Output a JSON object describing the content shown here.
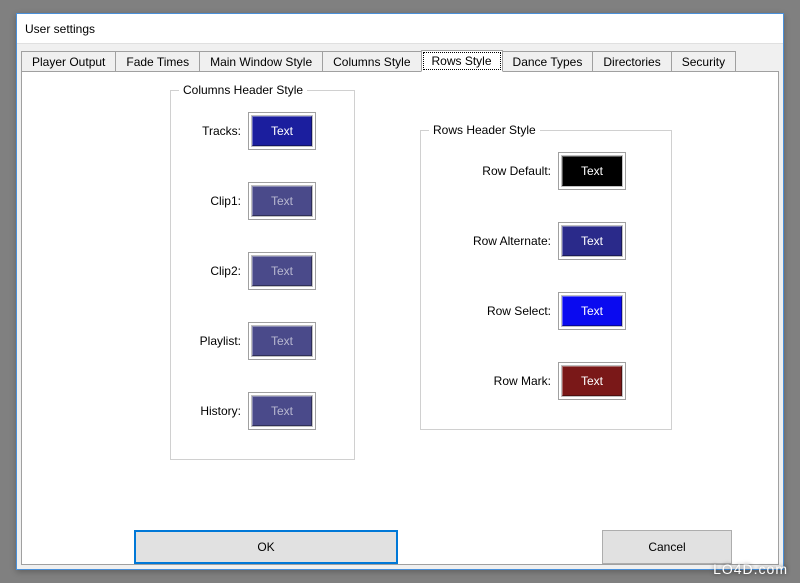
{
  "window": {
    "title": "User settings"
  },
  "tabs": {
    "t0": "Player Output",
    "t1": "Fade Times",
    "t2": "Main Window Style",
    "t3": "Columns Style",
    "t4": "Rows Style",
    "t5": "Dance Types",
    "t6": "Directories",
    "t7": "Security",
    "active": "t4"
  },
  "columnsGroup": {
    "legend": "Columns Header Style",
    "tracks": {
      "label": "Tracks:",
      "text": "Text",
      "bg": "#1b1e9e",
      "fg": "#ffffff"
    },
    "clip1": {
      "label": "Clip1:",
      "text": "Text",
      "bg": "#4a4a8a",
      "fg": "#b8b8d0"
    },
    "clip2": {
      "label": "Clip2:",
      "text": "Text",
      "bg": "#4a4a8a",
      "fg": "#b8b8d0"
    },
    "playlist": {
      "label": "Playlist:",
      "text": "Text",
      "bg": "#4a4a8a",
      "fg": "#b8b8d0"
    },
    "history": {
      "label": "History:",
      "text": "Text",
      "bg": "#4a4a8a",
      "fg": "#b8b8d0"
    }
  },
  "rowsGroup": {
    "legend": "Rows Header Style",
    "rowDefault": {
      "label": "Row Default:",
      "text": "Text",
      "bg": "#000000",
      "fg": "#ffffff"
    },
    "rowAlternate": {
      "label": "Row Alternate:",
      "text": "Text",
      "bg": "#2a2a8a",
      "fg": "#ffffff"
    },
    "rowSelect": {
      "label": "Row Select:",
      "text": "Text",
      "bg": "#0a0af0",
      "fg": "#ffffff"
    },
    "rowMark": {
      "label": "Row Mark:",
      "text": "Text",
      "bg": "#7a1818",
      "fg": "#ffffff"
    }
  },
  "buttons": {
    "ok": "OK",
    "cancel": "Cancel"
  },
  "watermark": "LO4D.com"
}
